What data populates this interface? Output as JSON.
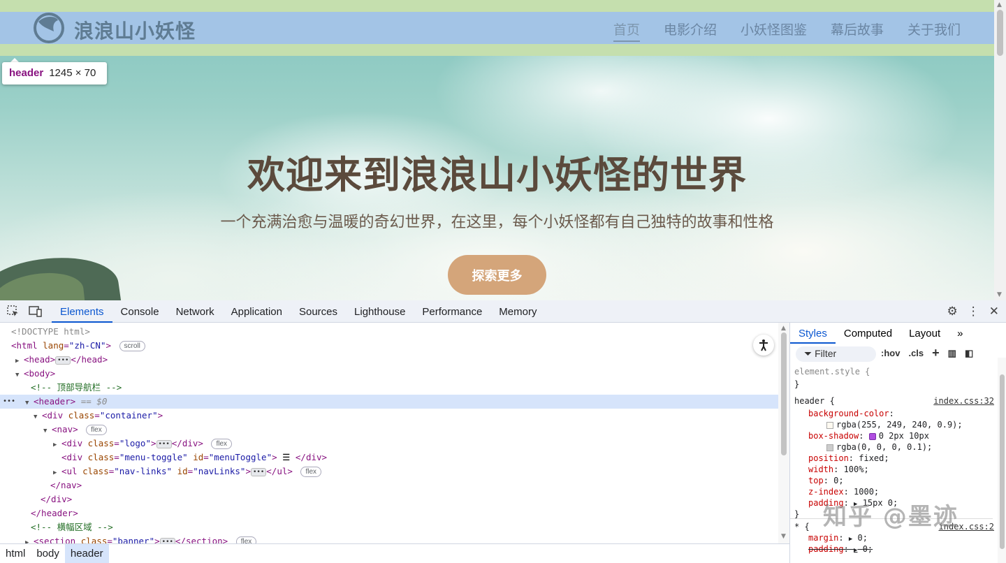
{
  "site": {
    "logo_text": "浪浪山小妖怪",
    "nav": [
      "首页",
      "电影介绍",
      "小妖怪图鉴",
      "幕后故事",
      "关于我们"
    ],
    "hero_title": "欢迎来到浪浪山小妖怪的世界",
    "hero_subtitle": "一个充满治愈与温暖的奇幻世界，在这里，每个小妖怪都有自己独特的故事和性格",
    "hero_button": "探索更多"
  },
  "tooltip": {
    "tag": "header",
    "size": "1245 × 70"
  },
  "devtools": {
    "tabs": [
      "Elements",
      "Console",
      "Network",
      "Application",
      "Sources",
      "Lighthouse",
      "Performance",
      "Memory"
    ],
    "active_tab": "Elements",
    "breadcrumb": [
      "html",
      "body",
      "header"
    ],
    "styles_tabs": [
      "Styles",
      "Computed",
      "Layout"
    ],
    "filter_placeholder": "Filter",
    "tools": [
      ":hov",
      ".cls"
    ],
    "dom": {
      "doctype": "<!DOCTYPE html>",
      "html_open": "<html ",
      "lang_attr": "lang",
      "lang_val": "\"zh-CN\"",
      "scroll_pill": "scroll",
      "head": "<head>",
      "head_close": "</head>",
      "body": "<body>",
      "comment_nav": "<!-- 顶部导航栏 -->",
      "header": "<header>",
      "eq": "== $0",
      "div_container": "<div ",
      "class_attr": "class",
      "container_val": "\"container\"",
      "nav": "<nav>",
      "flex_pill": "flex",
      "logo_val": "\"logo\"",
      "menu_val": "\"menu-toggle\"",
      "id_attr": "id",
      "menu_id": "\"menuToggle\"",
      "menu_text": " ☰ ",
      "div_close": "</div>",
      "ul_open": "<ul ",
      "navlinks_val": "\"nav-links\"",
      "navlinks_id": "\"navLinks\"",
      "ul_close": "</ul>",
      "nav_close": "</nav>",
      "header_close": "</header>",
      "comment_banner": "<!-- 横幅区域 -->",
      "section_open": "<section ",
      "banner_val": "\"banner\"",
      "section_close": "</section>"
    },
    "styles": {
      "element_style": "element.style {",
      "close_brace": "}",
      "header_selector": "header {",
      "header_source": "index.css:32",
      "bg_prop": "background-color",
      "bg_val": "rgba(255, 249, 240, 0.9);",
      "shadow_prop": "box-shadow",
      "shadow_val": "0 2px 10px",
      "shadow_val2": "rgba(0, 0, 0, 0.1);",
      "position_prop": "position",
      "position_val": "fixed;",
      "width_prop": "width",
      "width_val": "100%;",
      "top_prop": "top",
      "top_val": "0;",
      "z_prop": "z-index",
      "z_val": "1000;",
      "padding_prop": "padding",
      "padding_val": "15px 0;",
      "star_selector": "* {",
      "star_source": "index.css:2",
      "margin_prop": "margin",
      "margin_val": "0;",
      "padding2_prop": "padding",
      "padding2_val": "0;"
    }
  },
  "watermark": "知乎 @墨迹",
  "colors": {
    "highlight_margin": "#c5dfae",
    "highlight_content": "#a3c4e6",
    "button": "#d4a57a",
    "accent": "#0b57d0"
  }
}
